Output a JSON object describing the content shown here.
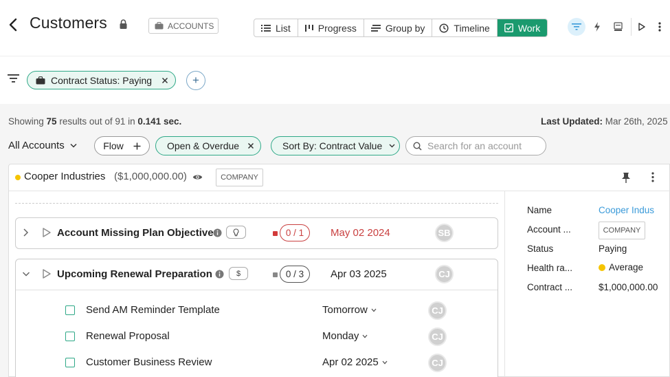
{
  "header": {
    "title": "Customers",
    "accounts_tag": "ACCOUNTS",
    "views": [
      {
        "label": "List",
        "icon": "list-icon"
      },
      {
        "label": "Progress",
        "icon": "progress-icon"
      },
      {
        "label": "Group by",
        "icon": "group-by-icon"
      },
      {
        "label": "Timeline",
        "icon": "clock-icon"
      },
      {
        "label": "Work",
        "icon": "check-square-icon",
        "active": true
      }
    ],
    "accent_color": "#1a9a6e"
  },
  "filters": {
    "chip": "Contract Status: Paying",
    "add_label": "+"
  },
  "results": {
    "showing_prefix": "Showing ",
    "count": "75",
    "mid1": " results out of 91 in ",
    "time": "0.141 sec.",
    "updated_label": "Last Updated:",
    "updated_value": " Mar 26th, 2025"
  },
  "toolbar": {
    "all_accounts": "All Accounts",
    "flow": "Flow",
    "open_overdue": "Open & Overdue",
    "sort": "Sort By: Contract Value",
    "search_placeholder": "Search for an account"
  },
  "account": {
    "name": "Cooper Industries",
    "value": "($1,000,000.00)",
    "tag": "COMPANY",
    "status_color": "#f5c400"
  },
  "tasks": [
    {
      "title": "Account Missing Plan Objective",
      "badge_icon": "lightbulb-icon",
      "count": "0 / 1",
      "date": "May 02 2024",
      "overdue": true,
      "avatar": "SB"
    },
    {
      "title": "Upcoming Renewal Preparation",
      "badge_icon": "dollar-icon",
      "badge": "$",
      "count": "0 / 3",
      "date": "Apr 03 2025",
      "overdue": false,
      "avatar": "CJ",
      "subtasks": [
        {
          "title": "Send AM Reminder Template",
          "date": "Tomorrow",
          "avatar": "CJ"
        },
        {
          "title": "Renewal Proposal",
          "date": "Monday",
          "avatar": "CJ"
        },
        {
          "title": "Customer Business Review",
          "date": "Apr 02 2025",
          "avatar": "CJ"
        }
      ]
    }
  ],
  "details": {
    "rows": [
      {
        "label": "Name",
        "value": "Cooper Indus"
      },
      {
        "label": "Account ...",
        "value": "COMPANY"
      },
      {
        "label": "Status",
        "value": "Paying"
      },
      {
        "label": "Health ra...",
        "value": "Average"
      },
      {
        "label": "Contract ...",
        "value": "$1,000,000.00"
      }
    ],
    "link_color": "#3a9ad9"
  }
}
